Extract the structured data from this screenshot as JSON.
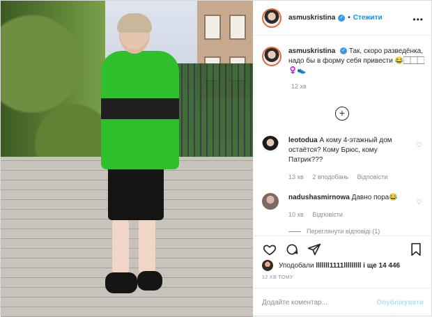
{
  "header": {
    "username": "asmuskristina",
    "separator": "•",
    "follow_label": "Стежити",
    "more_icon": "ellipsis-icon"
  },
  "caption": {
    "username": "asmuskristina",
    "text": "Так, скоро разведёнка, надо бы в форму себя привести 😂🏻🏻🏻♀️👟",
    "time": "12 хв"
  },
  "comments": [
    {
      "username": "leotodua",
      "text": "А кому 4-этажный дом остаётся? Кому Брюс, кому Патрик???",
      "time": "13 хв",
      "likes": "2 вподобань",
      "reply": "Відповісти"
    },
    {
      "username": "nadushasmirnowa",
      "text": "Давно пора😂",
      "time": "10 хв",
      "reply": "Відповісти"
    }
  ],
  "replies_label": "Переглянути відповіді (1)",
  "likes": {
    "prefix": "Уподобали",
    "user": "lllllll1111lllllllll",
    "suffix": "і ще 14 446"
  },
  "post_time": "12 ХВ ТОМУ",
  "add_comment": {
    "placeholder": "Додайте коментар...",
    "publish_label": "Опублікувати"
  },
  "colors": {
    "accent": "#0095f6",
    "verified": "#3897f0",
    "muted": "#8e8e8e",
    "jacket": "#2fbf2c"
  }
}
